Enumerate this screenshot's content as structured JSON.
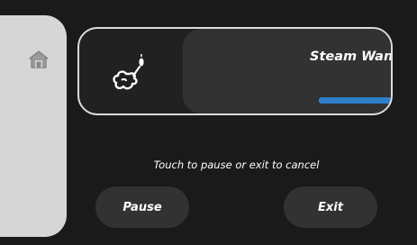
{
  "sidebar": {
    "home_icon": "home-icon"
  },
  "task": {
    "title": "Steam Wand Cleaning",
    "icon": "steam-wand-icon",
    "progress": 0.66
  },
  "hint_text": "Touch to pause or exit to cancel",
  "buttons": {
    "pause_label": "Pause",
    "exit_label": "Exit"
  },
  "colors": {
    "background": "#1b1a1a",
    "sidebar": "#d6d6d6",
    "panel": "#333232",
    "progress_fill": "#2d7fc8",
    "progress_track": "#d9d9d9",
    "text": "#ffffff"
  }
}
